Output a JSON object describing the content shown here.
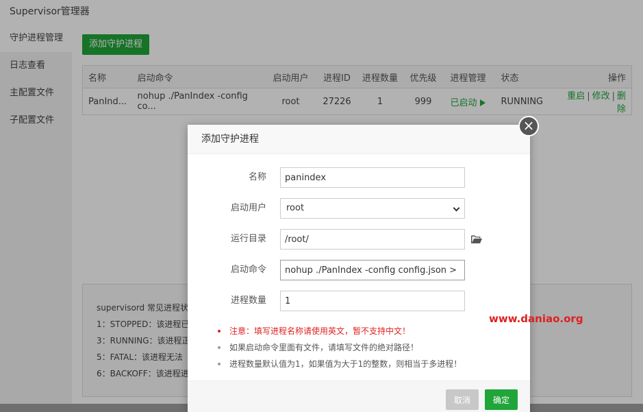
{
  "app": {
    "title": "Supervisor管理器"
  },
  "sidebar": {
    "items": [
      {
        "label": "守护进程管理"
      },
      {
        "label": "日志查看"
      },
      {
        "label": "主配置文件"
      },
      {
        "label": "子配置文件"
      }
    ]
  },
  "toolbar": {
    "add_label": "添加守护进程"
  },
  "table": {
    "headers": [
      "名称",
      "启动命令",
      "启动用户",
      "进程ID",
      "进程数量",
      "优先级",
      "进程管理",
      "状态",
      "操作"
    ],
    "rows": [
      {
        "name": "PanInd...",
        "command": "nohup ./PanIndex -config co...",
        "user": "root",
        "pid": "27226",
        "count": "1",
        "priority": "999",
        "manage": "已启动",
        "status": "RUNNING",
        "actions": {
          "restart": "重启",
          "edit": "修改",
          "delete": "删除",
          "sep": "|"
        }
      }
    ]
  },
  "info": {
    "lines": [
      "supervisord 常见进程状",
      "1：STOPPED：该进程已",
      "3：RUNNING：该进程正",
      "5：FATAL：该进程无法",
      "6：BACKOFF：该进程进"
    ]
  },
  "modal": {
    "title": "添加守护进程",
    "fields": {
      "name": {
        "label": "名称",
        "value": "panindex"
      },
      "user": {
        "label": "启动用户",
        "value": "root"
      },
      "dir": {
        "label": "运行目录",
        "value": "/root/"
      },
      "command": {
        "label": "启动命令",
        "value": "nohup ./PanIndex -config config.json > PanIn"
      },
      "count": {
        "label": "进程数量",
        "value": "1"
      }
    },
    "notes": [
      "注意：填写进程名称请使用英文，暂不支持中文！",
      "如果启动命令里面有文件，请填写文件的绝对路径！",
      "进程数量默认值为1，如果值为大于1的整数，则相当于多进程！"
    ],
    "cancel_label": "取消",
    "ok_label": "确定",
    "close_glyph": "×"
  },
  "watermark": "www.daniao.org",
  "colors": {
    "accent": "#20a53a",
    "warning": "#e02020"
  }
}
